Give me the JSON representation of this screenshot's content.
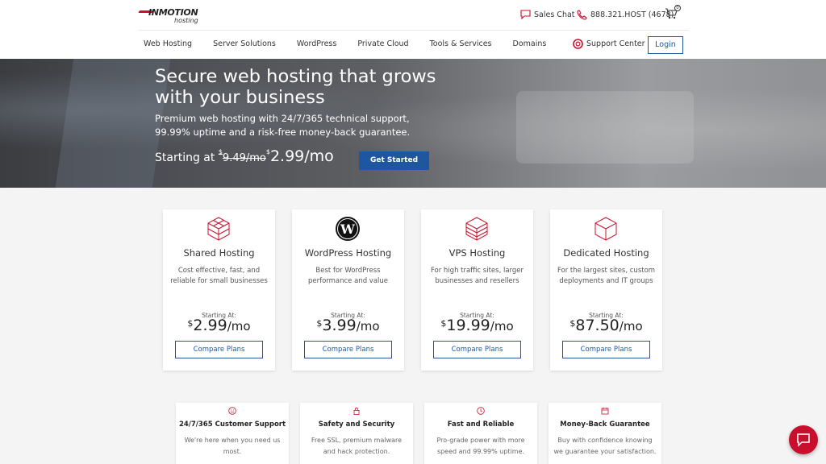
{
  "logo": {
    "brand": "INMOTION",
    "sub": "hosting"
  },
  "topbar": {
    "sales_chat": "Sales Chat",
    "phone": "888.321.HOST (4678)",
    "cart_count": "0"
  },
  "nav": {
    "items": [
      "Web Hosting",
      "Server Solutions",
      "WordPress",
      "Private Cloud",
      "Tools & Services",
      "Domains"
    ],
    "support": "Support Center",
    "login": "Login"
  },
  "hero": {
    "title": "Secure web hosting that grows with your business",
    "lead": "Premium web hosting with 24/7/365 technical support, 99.99% uptime and a risk-free money-back guarantee.",
    "starting_prefix": "Starting at",
    "currency": "$",
    "old_price": "9.49/mo",
    "new_price": "2.99/mo",
    "cta": "Get Started"
  },
  "cards": [
    {
      "title": "Shared Hosting",
      "desc": "Cost effective, fast, and reliable for small businesses",
      "start": "Starting At:",
      "currency": "$",
      "price": "2.99",
      "per": "/mo",
      "cta": "Compare Plans",
      "icon": "cube-grid-icon"
    },
    {
      "title": "WordPress Hosting",
      "desc": "Best for WordPress performance and value",
      "start": "Starting At:",
      "currency": "$",
      "price": "3.99",
      "per": "/mo",
      "cta": "Compare Plans",
      "icon": "wordpress-icon"
    },
    {
      "title": "VPS Hosting",
      "desc": "For high traffic sites, larger businesses and resellers",
      "start": "Starting At:",
      "currency": "$",
      "price": "19.99",
      "per": "/mo",
      "cta": "Compare Plans",
      "icon": "cube-layers-icon"
    },
    {
      "title": "Dedicated Hosting",
      "desc": "For the largest sites, custom deployments and IT groups",
      "start": "Starting At:",
      "currency": "$",
      "price": "87.50",
      "per": "/mo",
      "cta": "Compare Plans",
      "icon": "cube-icon"
    }
  ],
  "features": [
    {
      "title": "24/7/365 Customer Support",
      "desc": "We're here when you need us most.",
      "icon": "smile-icon"
    },
    {
      "title": "Safety and Security",
      "desc": "Free SSL, premium malware and hack protection.",
      "icon": "lock-icon"
    },
    {
      "title": "Fast and Reliable",
      "desc": "Pro-grade power with more speed and 99.99% uptime.",
      "icon": "clock-icon"
    },
    {
      "title": "Money-Back Guarantee",
      "desc": "Buy with confidence knowing we guarantee your satisfaction.",
      "icon": "calendar-icon"
    }
  ],
  "colors": {
    "accent": "#1e56a0",
    "brand": "#c8102e"
  }
}
